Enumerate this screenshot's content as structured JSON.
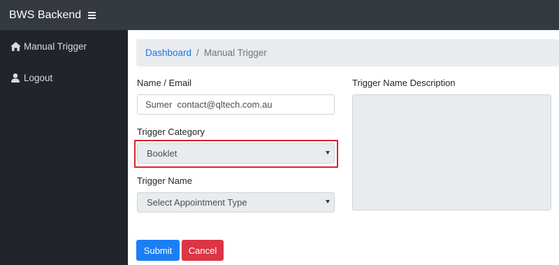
{
  "header": {
    "brand": "BWS Backend",
    "menu_icon": "hamburger-icon"
  },
  "sidebar": {
    "items": [
      {
        "label": "Manual Trigger",
        "icon": "home-icon"
      },
      {
        "label": "Logout",
        "icon": "user-icon"
      }
    ]
  },
  "breadcrumb": {
    "items": [
      "Dashboard",
      "Manual Trigger"
    ],
    "separator": "/"
  },
  "form": {
    "name_label": "Name / Email",
    "name_value": "Sumer  contact@qltech.com.au",
    "category_label": "Trigger Category",
    "category_value": "Booklet",
    "trigger_label": "Trigger Name",
    "trigger_value": "Select Appointment Type",
    "description_label": "Trigger Name Description",
    "description_value": ""
  },
  "buttons": {
    "submit": "Submit",
    "cancel": "Cancel"
  },
  "colors": {
    "topbar": "#343a40",
    "sidebar": "#212529",
    "primary": "#1a7ff5",
    "danger": "#dc3545",
    "highlight": "#d9232d"
  }
}
